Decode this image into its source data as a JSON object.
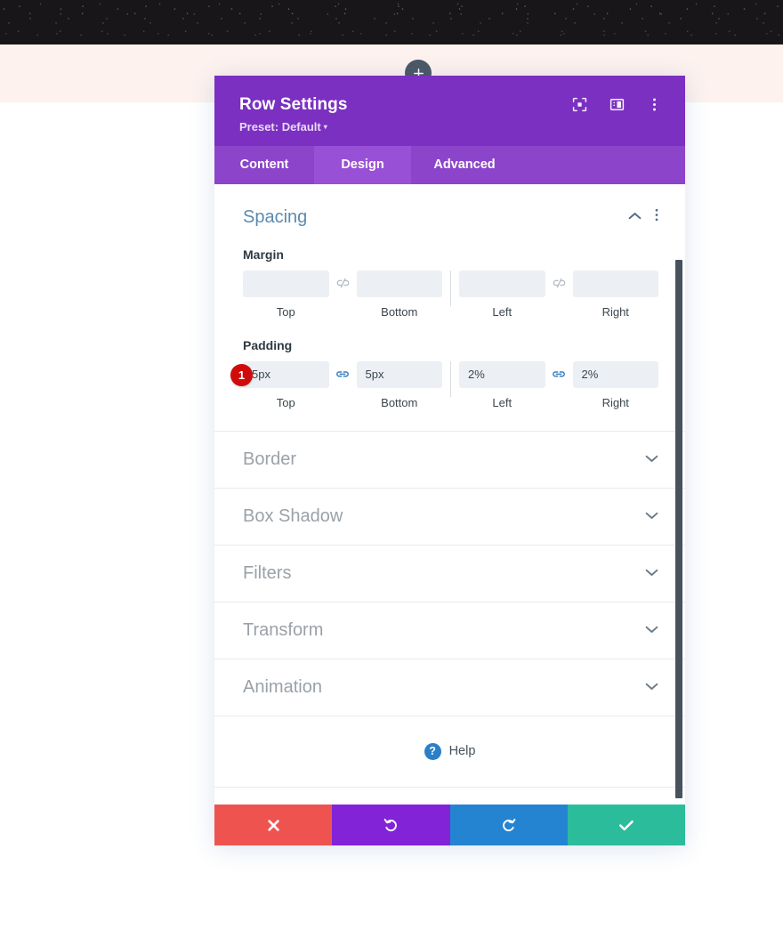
{
  "page": {
    "add_row_button": "+"
  },
  "modal": {
    "title": "Row Settings",
    "preset_label": "Preset: Default",
    "preset_caret": "▾",
    "header_icons": [
      {
        "name": "focus-icon"
      },
      {
        "name": "layout-icon"
      },
      {
        "name": "more-options-icon"
      }
    ],
    "tabs": [
      {
        "label": "Content",
        "active": false
      },
      {
        "label": "Design",
        "active": true
      },
      {
        "label": "Advanced",
        "active": false
      }
    ],
    "spacing": {
      "title": "Spacing",
      "margin": {
        "label": "Margin",
        "linked_left": false,
        "linked_right": false,
        "fields": [
          {
            "caption": "Top",
            "value": "",
            "placeholder": ""
          },
          {
            "caption": "Bottom",
            "value": "",
            "placeholder": ""
          },
          {
            "caption": "Left",
            "value": "",
            "placeholder": ""
          },
          {
            "caption": "Right",
            "value": "",
            "placeholder": ""
          }
        ]
      },
      "padding": {
        "label": "Padding",
        "badge": "1",
        "linked_left": true,
        "linked_right": true,
        "fields": [
          {
            "caption": "Top",
            "value": "5px",
            "placeholder": ""
          },
          {
            "caption": "Bottom",
            "value": "5px",
            "placeholder": ""
          },
          {
            "caption": "Left",
            "value": "2%",
            "placeholder": ""
          },
          {
            "caption": "Right",
            "value": "2%",
            "placeholder": ""
          }
        ]
      }
    },
    "collapsed_sections": [
      {
        "label": "Border"
      },
      {
        "label": "Box Shadow"
      },
      {
        "label": "Filters"
      },
      {
        "label": "Transform"
      },
      {
        "label": "Animation"
      }
    ],
    "help": {
      "icon_glyph": "?",
      "label": "Help"
    },
    "footer_buttons": [
      {
        "name": "cancel-button",
        "icon": "close-icon",
        "color": "#ef5350"
      },
      {
        "name": "undo-button",
        "icon": "undo-icon",
        "color": "#8223d7"
      },
      {
        "name": "redo-button",
        "icon": "redo-icon",
        "color": "#2484d2"
      },
      {
        "name": "save-button",
        "icon": "check-icon",
        "color": "#2bbc9b"
      }
    ]
  },
  "colors": {
    "header_purple": "#7b30c1",
    "tabbar_purple": "#8c45ca",
    "tab_active_purple": "#9850d6",
    "section_title_blue": "#5b8ab0",
    "collapsed_title_gray": "#9aa1a8",
    "badge_red": "#d10b0b",
    "link_active_blue": "#3a7fbf",
    "link_inactive_gray": "#b4bcc2",
    "cream_band": "#fdf2ee",
    "dark_band": "#181619"
  }
}
